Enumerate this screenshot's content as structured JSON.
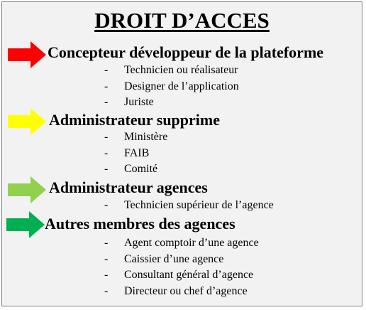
{
  "title": "DROIT D’ACCES",
  "colors": {
    "red": "#ff0000",
    "yellow": "#ffff00",
    "light_green": "#92d050",
    "green": "#00b050"
  },
  "sections": [
    {
      "heading": "Concepteur développeur de la plateforme",
      "arrow_icon": "right-arrow-icon",
      "arrow_color": "#ff0000",
      "items": [
        "Technicien ou réalisateur",
        "Designer de l’application",
        "Juriste"
      ]
    },
    {
      "heading": "Administrateur supprime",
      "arrow_icon": "right-arrow-icon",
      "arrow_color": "#ffff00",
      "items": [
        "Ministère",
        "FAIB",
        "Comité"
      ]
    },
    {
      "heading": "Administrateur agences",
      "arrow_icon": "right-arrow-icon",
      "arrow_color": "#92d050",
      "items": [
        "Technicien supérieur de l’agence"
      ]
    },
    {
      "heading": "Autres membres des agences",
      "arrow_icon": "right-arrow-icon",
      "arrow_color": "#00b050",
      "items": [
        "Agent comptoir d’une agence",
        "Caissier d’une agence",
        "Consultant général d’agence",
        "Directeur ou chef d’agence"
      ]
    }
  ],
  "bullet": "-"
}
